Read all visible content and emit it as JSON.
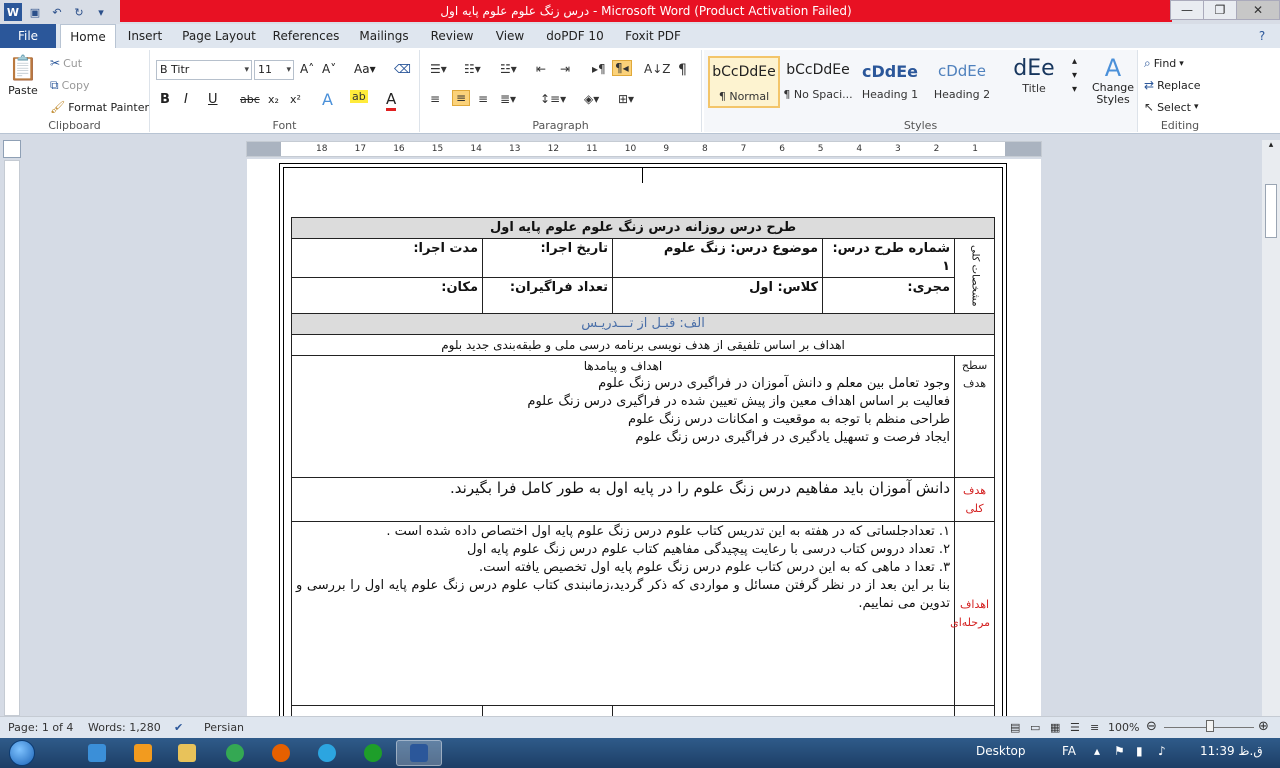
{
  "window": {
    "title": "درس زنگ علوم علوم پایه اول  -  Microsoft Word (Product Activation Failed)",
    "app_badge": "W"
  },
  "tabs": [
    "File",
    "Home",
    "Insert",
    "Page Layout",
    "References",
    "Mailings",
    "Review",
    "View",
    "doPDF 10",
    "Foxit PDF"
  ],
  "clipboard": {
    "paste": "Paste",
    "cut": "Cut",
    "copy": "Copy",
    "format_painter": "Format Painter",
    "label": "Clipboard"
  },
  "font": {
    "name": "B Titr",
    "size": "11",
    "label": "Font",
    "bold": "B",
    "italic": "I",
    "underline": "U",
    "strike": "abc",
    "sub": "x₂",
    "sup": "x²"
  },
  "paragraph": {
    "label": "Paragraph"
  },
  "styles": {
    "label": "Styles",
    "items": [
      {
        "sample": "bCcDdEe",
        "name": "¶ Normal"
      },
      {
        "sample": "bCcDdEe",
        "name": "¶ No Spaci..."
      },
      {
        "sample": "cDdEe",
        "name": "Heading 1"
      },
      {
        "sample": "cDdEe",
        "name": "Heading 2"
      },
      {
        "sample": "dEe",
        "name": "Title"
      }
    ],
    "change_styles": "Change Styles"
  },
  "editing": {
    "find": "Find",
    "replace": "Replace",
    "select": "Select",
    "label": "Editing"
  },
  "ruler": {
    "ticks": [
      "18",
      "17",
      "16",
      "15",
      "14",
      "13",
      "12",
      "11",
      "10",
      "9",
      "8",
      "7",
      "6",
      "5",
      "4",
      "3",
      "2",
      "1"
    ]
  },
  "doc": {
    "title_row": "طرح درس روزانه درس زنگ علوم علوم پایه اول",
    "side_label": "مشخصات کلی",
    "plan_number": "شماره طرح درس: ۱",
    "subject": "موضوع درس: زنگ علوم",
    "exec_date": "تاریخ اجرا:",
    "duration": "مدت اجرا:",
    "executor": "مجری:",
    "class": "کلاس:    اول",
    "participants": "تعداد فراگیران:",
    "place": "مکان:",
    "section_a": "الف: قبـل از تـــدریـس",
    "goals_header": "اهداف بر اساس تلفیقی از هدف نویسی برنامه درسی ملی و طبقه‌بندی جدید بلوم",
    "level_label": "سطح هدف",
    "goals_title": "اهداف و پیامدها",
    "goals": [
      "وجود تعامل بین معلم و دانش آموزان در فراگیری درس زنگ علوم",
      "فعالیت بر اساس اهداف معین واز پیش تعیین شده در فراگیری درس زنگ علوم",
      "طراحی منظم با توجه به موقعیت و امکانات درس زنگ علوم",
      "ایجاد فرصت و تسهیل یادگیری در فراگیری درس زنگ علوم"
    ],
    "general_label": "هدف کلی",
    "general_text": "دانش آموزان باید مفاهیم درس زنگ علوم را در پایه اول به طور کامل فرا بگیرند.",
    "stage_label": "اهداف مرحله‌ای",
    "stages": [
      "۱.     تعدادجلساتی که در هفته به این تدریس کتاب علوم درس زنگ علوم پایه اول اختصاص داده شده است .",
      "۲.     تعداد دروس کتاب درسی با رعایت پیچیدگی مفاهیم کتاب علوم درس زنگ علوم پایه اول",
      "۳.     تعدا د ماهی که به این درس کتاب علوم درس زنگ علوم پایه اول تخصیص یافته است.",
      "بنا بر این بعد از در نظر گرفتن مسائل و مواردی که ذکر گردید،زمانبندی کتاب علوم درس زنگ علوم پایه اول را بررسی و تدوین می نماییم."
    ]
  },
  "status": {
    "page": "Page: 1 of 4",
    "words": "Words: 1,280",
    "language": "Persian",
    "zoom": "100%"
  },
  "taskbar": {
    "desktop": "Desktop",
    "lang": "FA",
    "time": "11:39 ق.ظ"
  }
}
